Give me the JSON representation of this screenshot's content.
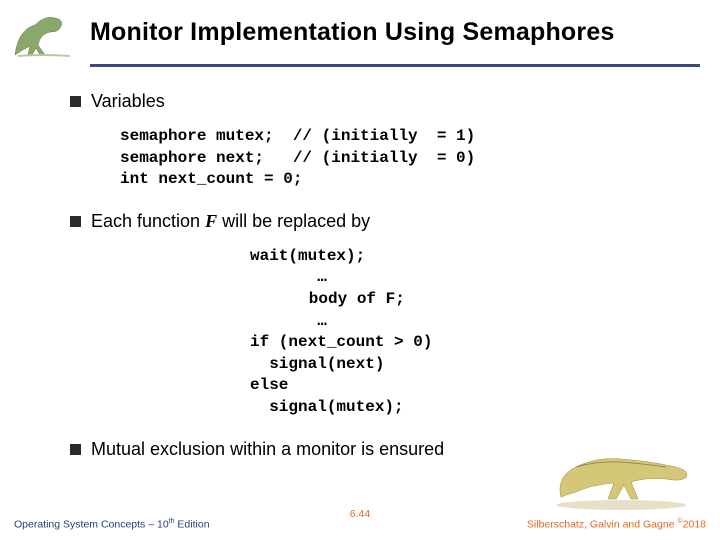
{
  "header": {
    "title": "Monitor Implementation Using Semaphores"
  },
  "bullets": {
    "b1": "Variables",
    "b2a": "Each function ",
    "b2b": "F",
    "b2c": "  will be replaced by",
    "b3": "Mutual exclusion within a monitor is ensured"
  },
  "code_block1": "semaphore mutex;  // (initially  = 1)\nsemaphore next;   // (initially  = 0)\nint next_count = 0;",
  "code_block2": {
    "l1": "wait(mutex);",
    "l2": "       …",
    "l3": "   body of F;",
    "l4": "       …",
    "l5": "if (next_count > 0)",
    "l6": "  signal(next)",
    "l7": "else",
    "l8": "  signal(mutex);"
  },
  "footer": {
    "left_a": "Operating System Concepts – 10",
    "left_b": "th",
    "left_c": " Edition",
    "center": "6.44",
    "right_a": "Silberschatz, Galvin and Gagne ",
    "right_b": "©",
    "right_c": "2018"
  }
}
